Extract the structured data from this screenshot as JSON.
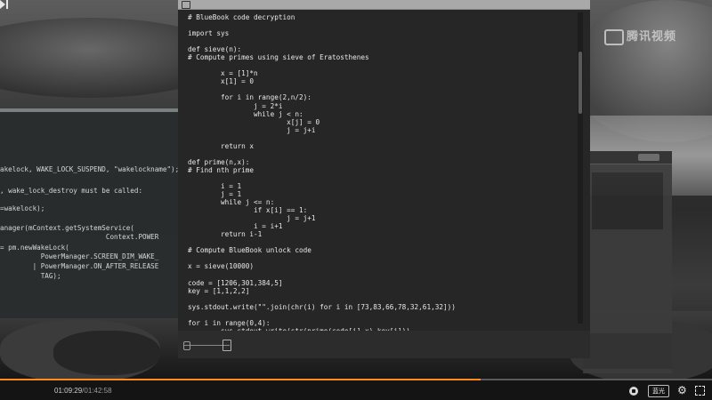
{
  "watermark": {
    "text": "腾讯视频"
  },
  "editor": {
    "code": "# BlueBook code decryption\n\nimport sys\n\ndef sieve(n):\n# Compute primes using sieve of Eratosthenes\n\n        x = [1]*n\n        x[1] = 0\n\n        for i in range(2,n/2):\n                j = 2*i\n                while j < n:\n                        x[j] = 0\n                        j = j+i\n\n        return x\n\ndef prime(n,x):\n# Find nth prime\n\n        i = 1\n        j = 1\n        while j <= n:\n                if x[i] == 1:\n                        j = j+1\n                i = i+1\n        return i-1\n\n# Compute BlueBook unlock code\n\nx = sieve(10000)\n\ncode = [1206,301,384,5]\nkey = [1,1,2,2]\n\nsys.stdout.write(\"\".join(chr(i) for i in [73,83,66,78,32,61,32]))\n\nfor i in range(0,4):\n        sys.stdout.write(str(prime(code[i],x)-key[i]))\n\np"
  },
  "left_window": {
    "lines": [
      "akelock, WAKE_LOCK_SUSPEND, \"wakelockname\");",
      ", wake_lock_destroy must be called:",
      "=wakelock);",
      "anager(mContext.getSystemService(",
      "                          Context.POWER",
      "= pm.newWakeLock(",
      "          PowerManager.SCREEN_DIM_WAKE_",
      "        | PowerManager.ON_AFTER_RELEASE",
      "          TAG);"
    ]
  },
  "player": {
    "current_time": "01:09:29",
    "separator": "/",
    "total_time": "01:42:58",
    "progress": 0.675,
    "quality_label": "蓝光",
    "accent_color": "#ff8a1f"
  }
}
